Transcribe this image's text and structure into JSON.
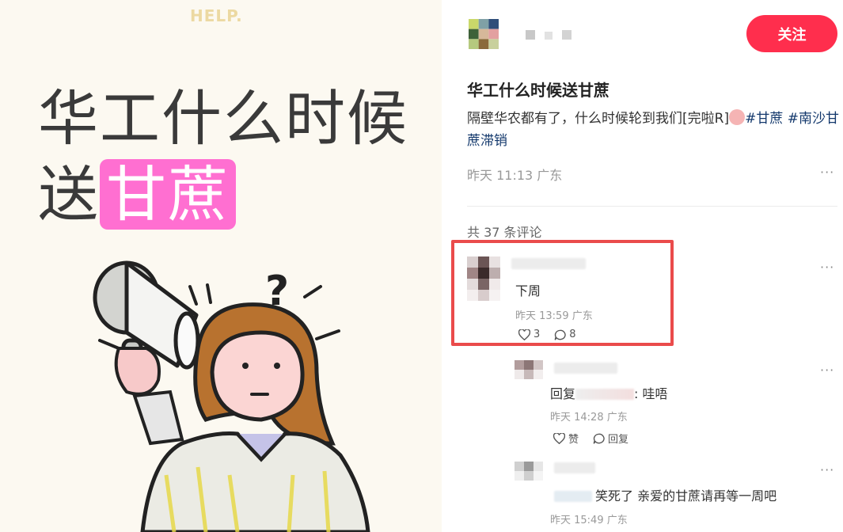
{
  "media": {
    "help_text": "HELP.",
    "headline_line1": "华工什么时候",
    "headline_prefix": "送",
    "headline_highlight": "甘蔗"
  },
  "author": {
    "follow_label": "关注"
  },
  "post": {
    "title": "华工什么时候送甘蔗",
    "body": "隔壁华农都有了，什么时候轮到我们[完啦R]",
    "tag1": "#甘蔗",
    "tag2": "#南沙甘蔗滞销",
    "meta": "昨天 11:13 广东",
    "more": "···"
  },
  "comments": {
    "count_label": "共 37 条评论",
    "items": [
      {
        "text": "下周",
        "meta": "昨天 13:59 广东",
        "likes": "3",
        "replies": "8",
        "more": "···"
      },
      {
        "reply_prefix": "回复",
        "text": ": 哇唔",
        "meta": "昨天 14:28 广东",
        "like_label": "赞",
        "reply_label": "回复",
        "more": "···"
      },
      {
        "text": "笑死了 亲爱的甘蔗请再等一周吧",
        "meta": "昨天 15:49 广东",
        "more": "···"
      }
    ]
  },
  "colors": {
    "follow": "#ff2e4d",
    "highlight_box": "#ea4b4b",
    "tag": "#13386c",
    "headline_highlight": "#ff6fd1"
  }
}
